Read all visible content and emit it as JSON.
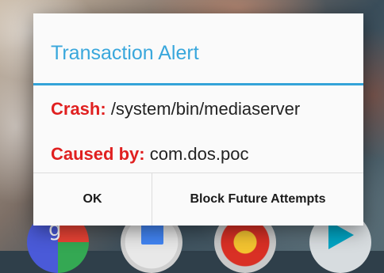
{
  "dialog": {
    "title": "Transaction Alert",
    "crash_label": "Crash:",
    "crash_value": "/system/bin/mediaserver",
    "caused_label": "Caused by:",
    "caused_value": "com.dos.poc",
    "ok_label": "OK",
    "block_label": "Block Future Attempts"
  },
  "colors": {
    "title": "#39a7dc",
    "divider": "#33a3d8",
    "label_red": "#e02020"
  },
  "dock": {
    "google_glyph": "g",
    "icons": [
      "google-folder-icon",
      "docs-icon",
      "chrome-icon",
      "play-store-icon"
    ]
  }
}
